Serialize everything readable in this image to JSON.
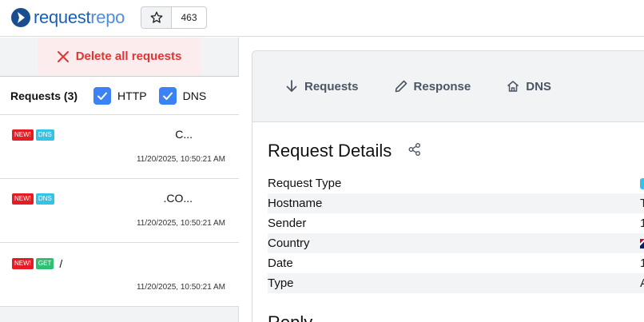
{
  "app": {
    "logo_part1": "request",
    "logo_part2": "repo",
    "star_count": "463",
    "colors": {
      "accent": "#3b82f6",
      "danger": "#e03535",
      "brand": "#1a5fb4"
    }
  },
  "sidebar": {
    "delete_label": "Delete all requests",
    "requests_label": "Requests (3)",
    "filters": [
      {
        "label": "HTTP",
        "checked": true
      },
      {
        "label": "DNS",
        "checked": true
      }
    ],
    "requests": [
      {
        "new_badge": "NEW!",
        "type_badge": "DNS",
        "path": "",
        "name": "C...",
        "time": "11/20/2025, 10:50:21 AM"
      },
      {
        "new_badge": "NEW!",
        "type_badge": "DNS",
        "path": "",
        "name": ".CO...",
        "time": "11/20/2025, 10:50:21 AM"
      },
      {
        "new_badge": "NEW!",
        "type_badge": "GET",
        "path": "/",
        "name": "",
        "time": "11/20/2025, 10:50:21 AM"
      }
    ]
  },
  "main": {
    "tabs": [
      {
        "label": "Requests",
        "icon": "arrow-down-icon"
      },
      {
        "label": "Response",
        "icon": "pencil-icon"
      },
      {
        "label": "DNS",
        "icon": "home-icon"
      }
    ],
    "details_title": "Request Details",
    "details": [
      {
        "key": "Request Type",
        "value": ""
      },
      {
        "key": "Hostname",
        "value": "T"
      },
      {
        "key": "Sender",
        "value": "1"
      },
      {
        "key": "Country",
        "value": ""
      },
      {
        "key": "Date",
        "value": "1"
      },
      {
        "key": "Type",
        "value": "A"
      }
    ],
    "next_section_partial": "Reply"
  }
}
